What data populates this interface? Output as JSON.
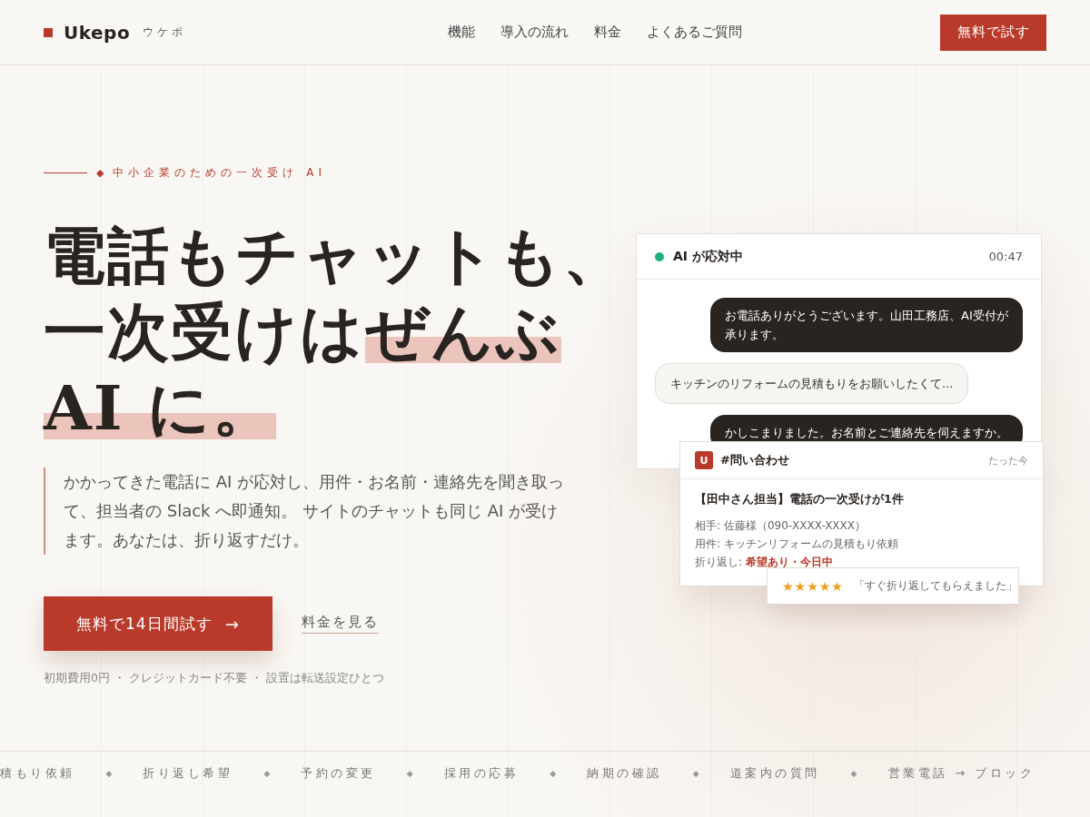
{
  "header": {
    "logo": "Ukepo",
    "logo_kana": "ウケポ",
    "nav": [
      "機能",
      "導入の流れ",
      "料金",
      "よくあるご質問"
    ],
    "cta": "無料で試す"
  },
  "hero": {
    "eyebrow": "中小企業のための一次受け AI",
    "eyebrow_mark": "◆",
    "headline": [
      [
        {
          "text": "電話もチャットも、",
          "highlight": false
        }
      ],
      [
        {
          "text": "一次受けは",
          "highlight": false
        },
        {
          "text": "ぜんぶ",
          "highlight": true
        }
      ],
      [
        {
          "text": "AI に。",
          "highlight": true
        }
      ]
    ],
    "lead": "かかってきた電話に AI が応対し、用件・お名前・連絡先を聞き取って、担当者の Slack へ即通知。 サイトのチャットも同じ AI が受けます。あなたは、折り返すだけ。",
    "primary_button": "無料で14日間試す",
    "primary_arrow": "→",
    "secondary_link": "料金を見る",
    "notes": [
      "初期費用0円",
      "クレジットカード不要",
      "設置は転送設定ひとつ"
    ],
    "note_sep": "・"
  },
  "call_panel": {
    "status": "AI が応対中",
    "live": true,
    "timer": "00:47",
    "messages": [
      {
        "kind": "ai",
        "text": "お電話ありがとうございます。山田工務店、AI受付が承ります。"
      },
      {
        "kind": "caller",
        "text": "キッチンのリフォームの見積もりをお願いしたくて..."
      },
      {
        "kind": "ai",
        "text": "かしこまりました。お名前とご連絡先を伺えますか。"
      }
    ]
  },
  "notification": {
    "avatar": "U",
    "channel": "#問い合わせ",
    "time": "たった今",
    "title": "【田中さん担当】電話の一次受けが1件",
    "fields": [
      {
        "label": "相手:",
        "value": "佐藤様（090-XXXX-XXXX）",
        "emphasis": false
      },
      {
        "label": "用件:",
        "value": "キッチンリフォームの見積もり依頼",
        "emphasis": false
      },
      {
        "label": "折り返し:",
        "value": "希望あり・今日中",
        "emphasis": true
      }
    ]
  },
  "review": {
    "stars": 5,
    "quote": "「すぐ折り返してもらえました」"
  },
  "ticker": {
    "items": [
      "積もり依頼",
      "折り返し希望",
      "予約の変更",
      "採用の応募",
      "納期の確認",
      "道案内の質問",
      "営業電話 → ブロック"
    ],
    "separator": "◆"
  }
}
